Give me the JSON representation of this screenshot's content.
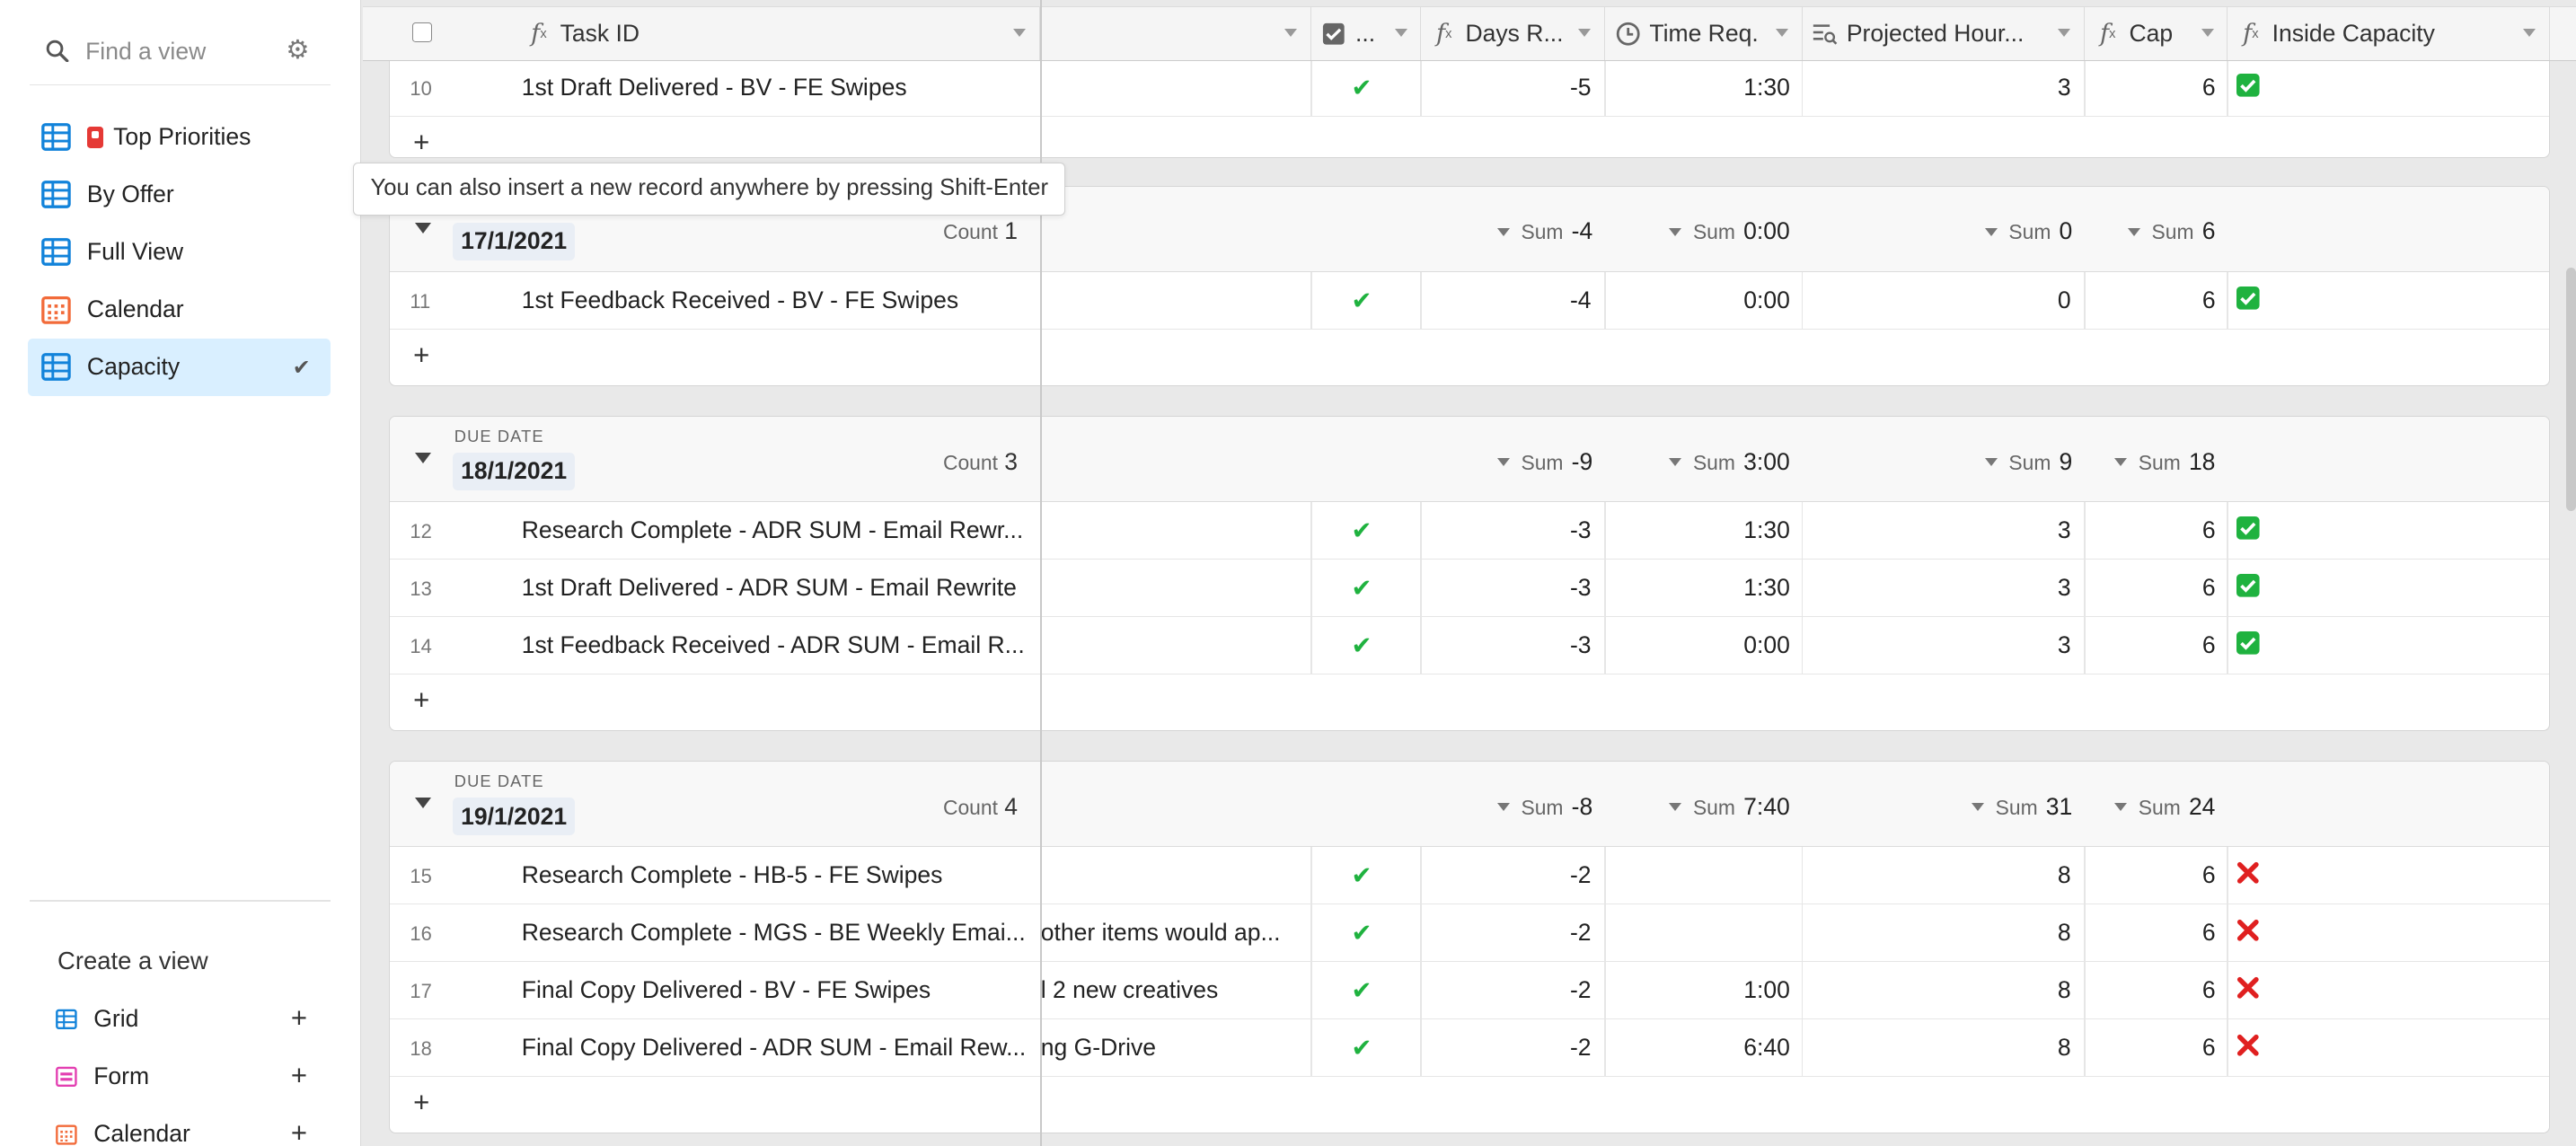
{
  "sidebar": {
    "search_placeholder": "Find a view",
    "views": [
      {
        "label": "Top Priorities",
        "icon": "grid-icon",
        "emoji": "rotating-light-icon",
        "selected": false
      },
      {
        "label": "By Offer",
        "icon": "grid-icon",
        "selected": false
      },
      {
        "label": "Full View",
        "icon": "grid-icon",
        "selected": false
      },
      {
        "label": "Calendar",
        "icon": "calendar-icon",
        "selected": false
      },
      {
        "label": "Capacity",
        "icon": "grid-icon",
        "selected": true
      }
    ],
    "create_title": "Create a view",
    "create_items": [
      {
        "label": "Grid",
        "icon": "grid-icon"
      },
      {
        "label": "Form",
        "icon": "form-icon"
      },
      {
        "label": "Calendar",
        "icon": "calendar-icon"
      }
    ]
  },
  "colors": {
    "accent_blue": "#1283da",
    "selected_bg": "#d9efff",
    "check_green": "#1fb23f",
    "cross_red": "#e02020",
    "calendar_orange": "#f26b3a",
    "form_pink": "#e33fb1"
  },
  "columns": {
    "task": "Task ID",
    "check_col": "...",
    "days": "Days R...",
    "time": "Time Req.",
    "projected": "Projected Hour...",
    "cap": "Cap",
    "inside": "Inside Capacity"
  },
  "tooltip": "You can also insert a new record anywhere by pressing Shift-Enter",
  "group_label": "DUE DATE",
  "top_row": {
    "num": "10",
    "task": "1st Draft Delivered - BV - FE Swipes",
    "note": "",
    "done": true,
    "days": "-5",
    "time": "1:30",
    "proj": "3",
    "cap": "6",
    "inside": true
  },
  "groups": [
    {
      "date": "17/1/2021",
      "count_label": "Count",
      "count": "1",
      "sums": {
        "days": "-4",
        "time": "0:00",
        "proj": "0",
        "cap": "6"
      },
      "rows": [
        {
          "num": "11",
          "task": "1st Feedback Received - BV - FE Swipes",
          "note": "",
          "done": true,
          "days": "-4",
          "time": "0:00",
          "proj": "0",
          "cap": "6",
          "inside": true
        }
      ]
    },
    {
      "date": "18/1/2021",
      "count_label": "Count",
      "count": "3",
      "sums": {
        "days": "-9",
        "time": "3:00",
        "proj": "9",
        "cap": "18"
      },
      "rows": [
        {
          "num": "12",
          "task": "Research Complete - ADR SUM - Email Rewr...",
          "note": "",
          "done": true,
          "days": "-3",
          "time": "1:30",
          "proj": "3",
          "cap": "6",
          "inside": true
        },
        {
          "num": "13",
          "task": "1st Draft Delivered - ADR SUM - Email Rewrite",
          "note": "",
          "done": true,
          "days": "-3",
          "time": "1:30",
          "proj": "3",
          "cap": "6",
          "inside": true
        },
        {
          "num": "14",
          "task": "1st Feedback Received - ADR SUM - Email R...",
          "note": "",
          "done": true,
          "days": "-3",
          "time": "0:00",
          "proj": "3",
          "cap": "6",
          "inside": true
        }
      ]
    },
    {
      "date": "19/1/2021",
      "count_label": "Count",
      "count": "4",
      "sums": {
        "days": "-8",
        "time": "7:40",
        "proj": "31",
        "cap": "24"
      },
      "rows": [
        {
          "num": "15",
          "task": "Research Complete - HB-5 - FE Swipes",
          "note": "",
          "done": true,
          "days": "-2",
          "time": "",
          "proj": "8",
          "cap": "6",
          "inside": false
        },
        {
          "num": "16",
          "task": "Research Complete - MGS - BE Weekly Emai...",
          "note": "other items would ap...",
          "done": true,
          "days": "-2",
          "time": "",
          "proj": "8",
          "cap": "6",
          "inside": false
        },
        {
          "num": "17",
          "task": "Final Copy Delivered - BV - FE Swipes",
          "note": "l 2 new creatives",
          "done": true,
          "days": "-2",
          "time": "1:00",
          "proj": "8",
          "cap": "6",
          "inside": false
        },
        {
          "num": "18",
          "task": "Final Copy Delivered - ADR SUM - Email Rew...",
          "note": "ng G-Drive",
          "done": true,
          "days": "-2",
          "time": "6:40",
          "proj": "8",
          "cap": "6",
          "inside": false
        }
      ]
    }
  ],
  "sum_label": "Sum"
}
